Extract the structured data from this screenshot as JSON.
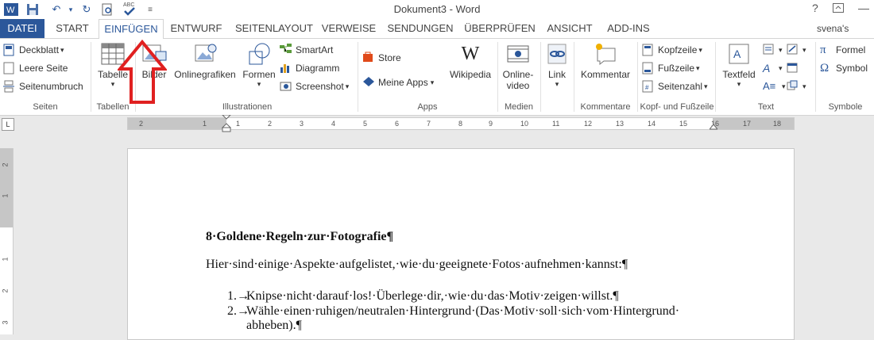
{
  "window": {
    "title": "Dokument3 - Word",
    "help": "?",
    "user": "svena's space"
  },
  "tabs": [
    {
      "label": "DATEI"
    },
    {
      "label": "START"
    },
    {
      "label": "EINFÜGEN"
    },
    {
      "label": "ENTWURF"
    },
    {
      "label": "SEITENLAYOUT"
    },
    {
      "label": "VERWEISE"
    },
    {
      "label": "SENDUNGEN"
    },
    {
      "label": "ÜBERPRÜFEN"
    },
    {
      "label": "ANSICHT"
    },
    {
      "label": "ADD-INS"
    }
  ],
  "ribbon": {
    "seiten": {
      "label": "Seiten",
      "deckblatt": "Deckblatt",
      "leere_seite": "Leere Seite",
      "seitenumbruch": "Seitenumbruch"
    },
    "tabellen": {
      "label": "Tabellen",
      "tabelle": "Tabelle"
    },
    "illustrationen": {
      "label": "Illustrationen",
      "bilder": "Bilder",
      "onlinegrafiken": "Onlinegrafiken",
      "formen": "Formen",
      "smartart": "SmartArt",
      "diagramm": "Diagramm",
      "screenshot": "Screenshot"
    },
    "apps": {
      "label": "Apps",
      "store": "Store",
      "meine_apps": "Meine Apps",
      "wikipedia": "Wikipedia"
    },
    "medien": {
      "label": "Medien",
      "online_video_1": "Online-",
      "online_video_2": "video"
    },
    "links": {
      "link": "Link"
    },
    "kommentare": {
      "label": "Kommentare",
      "kommentar": "Kommentar"
    },
    "kopf_fuss": {
      "label": "Kopf- und Fußzeile",
      "kopfzeile": "Kopfzeile",
      "fusszeile": "Fußzeile",
      "seitenzahl": "Seitenzahl"
    },
    "text": {
      "label": "Text",
      "textfeld": "Textfeld"
    },
    "symbole": {
      "label": "Symbole",
      "formel": "Formel",
      "symbol": "Symbol"
    }
  },
  "ruler": {
    "h_numbers": [
      "2",
      "1",
      "1",
      "2",
      "3",
      "4",
      "5",
      "6",
      "7",
      "8",
      "9",
      "10",
      "11",
      "12",
      "13",
      "14",
      "15",
      "16",
      "17",
      "18"
    ],
    "v_numbers": [
      "2",
      "1",
      "1",
      "2",
      "3"
    ],
    "corner": "L"
  },
  "document": {
    "heading": "8·Goldene·Regeln·zur·Fotografie¶",
    "intro": "Hier·sind·einige·Aspekte·aufgelistet,·wie·du·geeignete·Fotos·aufnehmen·kannst:¶",
    "item1_num": "1.→",
    "item1": "Knipse·nicht·darauf·los!·Überlege·dir,·wie·du·das·Motiv·zeigen·willst.¶",
    "item2_num": "2.→",
    "item2_line1": "Wähle·einen·ruhigen/neutralen·Hintergrund·(Das·Motiv·soll·sich·vom·Hintergrund·",
    "item2_line2": "abheben).¶"
  },
  "colors": {
    "accent": "#2b579a",
    "annotation_arrow": "#e02020"
  }
}
